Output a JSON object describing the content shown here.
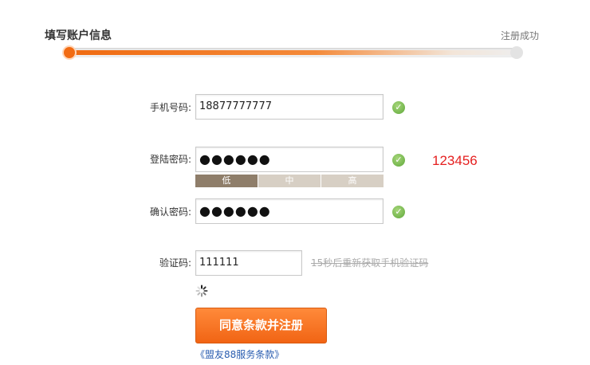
{
  "steps": {
    "current": "填写账户信息",
    "final": "注册成功",
    "progress_fraction": 0.0
  },
  "form": {
    "phone": {
      "label": "手机号码:",
      "value": "18877777777"
    },
    "password": {
      "label": "登陆密码:",
      "value_masked": "●●●●●●"
    },
    "strength": {
      "low": "低",
      "mid": "中",
      "high": "高",
      "level": "low"
    },
    "confirm": {
      "label": "确认密码:",
      "value_masked": "●●●●●●"
    },
    "captcha": {
      "label": "验证码:",
      "value": "111111",
      "resend_text": "15秒后重新获取手机验证码"
    }
  },
  "annotation": "123456",
  "submit_label": "同意条款并注册",
  "terms_link": "《盟友88服务条款》",
  "colors": {
    "accent": "#f16414",
    "check": "#5fa83a",
    "link": "#2a5db0",
    "annotation": "#e52020"
  }
}
